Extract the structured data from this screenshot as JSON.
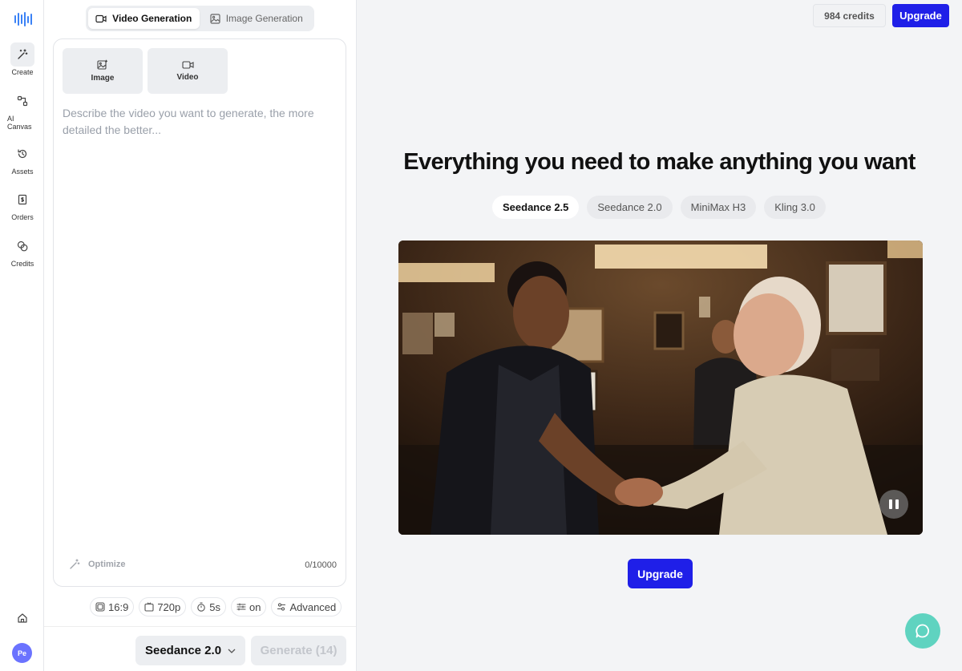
{
  "sidebar": {
    "items": [
      {
        "label": "Create",
        "icon": "magic-wand-icon",
        "active": true
      },
      {
        "label": "AI Canvas",
        "icon": "nodes-icon"
      },
      {
        "label": "Assets",
        "icon": "history-icon"
      },
      {
        "label": "Orders",
        "icon": "receipt-icon"
      },
      {
        "label": "Credits",
        "icon": "coins-icon"
      }
    ],
    "home_icon": "home-icon",
    "avatar_initials": "Pe"
  },
  "mode_tabs": [
    {
      "label": "Video Generation",
      "icon": "video-icon",
      "active": true
    },
    {
      "label": "Image Generation",
      "icon": "image-icon",
      "active": false
    }
  ],
  "prompt": {
    "upload_buttons": [
      {
        "label": "Image",
        "icon": "image-add-icon"
      },
      {
        "label": "Video",
        "icon": "video-icon"
      }
    ],
    "placeholder": "Describe the video you want to generate, the more detailed the better...",
    "value": "",
    "optimize_label": "Optimize",
    "counter": "0/10000"
  },
  "settings": {
    "aspect_ratio": "16:9",
    "resolution": "720p",
    "duration": "5s",
    "audio": "on",
    "advanced": "Advanced"
  },
  "footer": {
    "model": "Seedance 2.0",
    "generate_label": "Generate (14)"
  },
  "header": {
    "credits": "984 credits",
    "upgrade_label": "Upgrade"
  },
  "main": {
    "headline": "Everything you need to make anything you want",
    "model_tabs": [
      {
        "label": "Seedance 2.5",
        "active": true
      },
      {
        "label": "Seedance 2.0",
        "active": false
      },
      {
        "label": "MiniMax H3",
        "active": false
      },
      {
        "label": "Kling 3.0",
        "active": false
      }
    ],
    "upgrade_label": "Upgrade"
  },
  "colors": {
    "accent": "#1f1fe8",
    "chat_button": "#5fd3c0",
    "avatar": "#6b73ff"
  }
}
